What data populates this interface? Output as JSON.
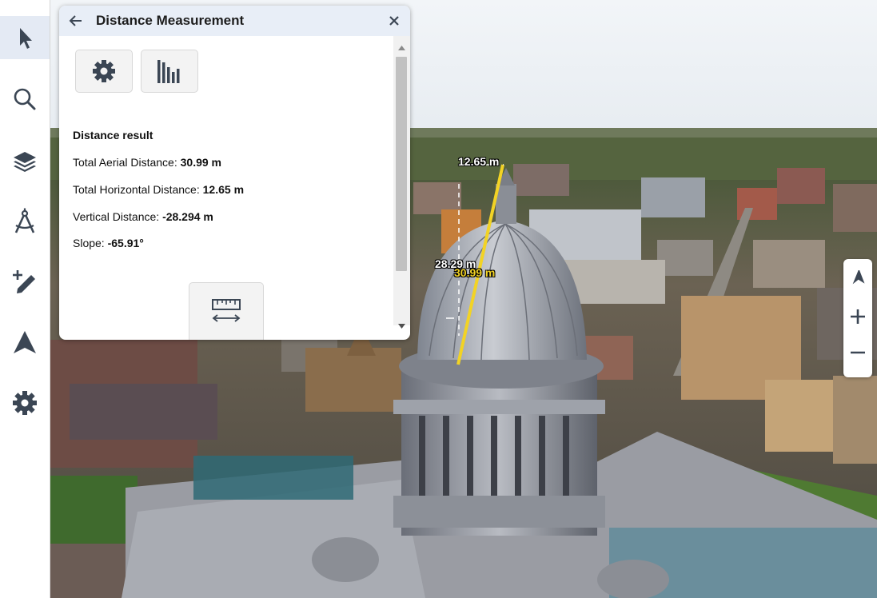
{
  "toolbar": {
    "items": [
      {
        "name": "select",
        "icon": "cursor-arrow-icon",
        "active": true
      },
      {
        "name": "search",
        "icon": "search-icon"
      },
      {
        "name": "layers",
        "icon": "layers-icon"
      },
      {
        "name": "measure",
        "icon": "compass-icon"
      },
      {
        "name": "sketch",
        "icon": "add-edit-icon"
      },
      {
        "name": "navigate",
        "icon": "navigation-arrow-icon"
      },
      {
        "name": "settings",
        "icon": "gear-icon"
      }
    ]
  },
  "panel": {
    "title": "Distance Measurement",
    "back_icon": "arrow-left-icon",
    "close_icon": "close-icon",
    "settings_icon": "gear-icon",
    "chart_icon": "bar-chart-icon",
    "result_title": "Distance result",
    "rows": [
      {
        "label": "Total Aerial Distance: ",
        "value": "30.99 m"
      },
      {
        "label": "Total Horizontal Distance: ",
        "value": "12.65 m"
      },
      {
        "label": "Vertical Distance: ",
        "value": "-28.294 m"
      },
      {
        "label": "Slope: ",
        "value": "-65.91°"
      }
    ],
    "ruler_icon": "ruler-icon"
  },
  "map_labels": {
    "horizontal": "12.65 m",
    "vertical": "28.29 m",
    "aerial": "30.99 m"
  },
  "nav": {
    "compass_icon": "compass-north-icon",
    "zoom_in_icon": "plus-icon",
    "zoom_out_icon": "minus-icon"
  },
  "colors": {
    "accent_header": "#e8eef7",
    "measure_line": "#f2d325",
    "label_white": "#ffffff",
    "label_yellow": "#f2d325"
  }
}
